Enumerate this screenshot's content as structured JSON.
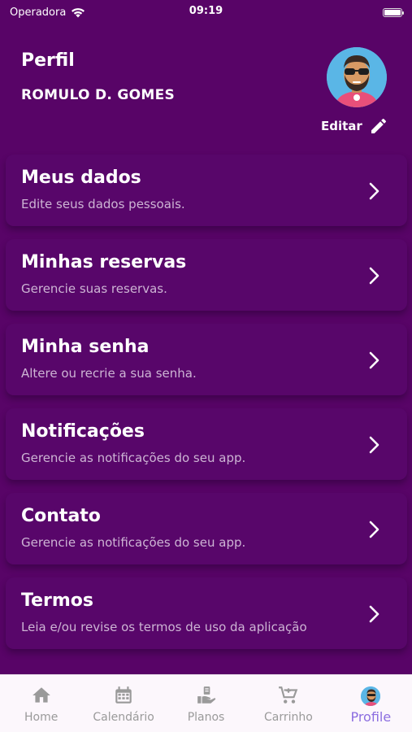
{
  "status_bar": {
    "carrier": "Operadora",
    "time": "09:19"
  },
  "header": {
    "title": "Perfil",
    "user_name": "ROMULO D. GOMES",
    "edit_label": "Editar"
  },
  "menu": [
    {
      "title": "Meus dados",
      "subtitle": "Edite seus dados pessoais."
    },
    {
      "title": "Minhas reservas",
      "subtitle": "Gerencie suas reservas."
    },
    {
      "title": "Minha senha",
      "subtitle": "Altere ou recrie a sua senha."
    },
    {
      "title": "Notificações",
      "subtitle": "Gerencie as notificações do seu app."
    },
    {
      "title": "Contato",
      "subtitle": "Gerencie as notificações do seu app."
    },
    {
      "title": "Termos",
      "subtitle": "Leia e/ou revise os termos de uso da aplicação"
    }
  ],
  "tabs": [
    {
      "label": "Home",
      "icon": "home-icon"
    },
    {
      "label": "Calendário",
      "icon": "calendar-icon"
    },
    {
      "label": "Planos",
      "icon": "plans-icon"
    },
    {
      "label": "Carrinho",
      "icon": "cart-icon"
    },
    {
      "label": "Profile",
      "icon": "avatar",
      "active": true
    }
  ],
  "colors": {
    "background": "#580467",
    "card": "#58066a",
    "tab_bar": "#fcf7fc",
    "tab_active": "#8c6ee0",
    "tab_inactive": "#9a9a9a",
    "subtitle": "#cdb4d4"
  }
}
